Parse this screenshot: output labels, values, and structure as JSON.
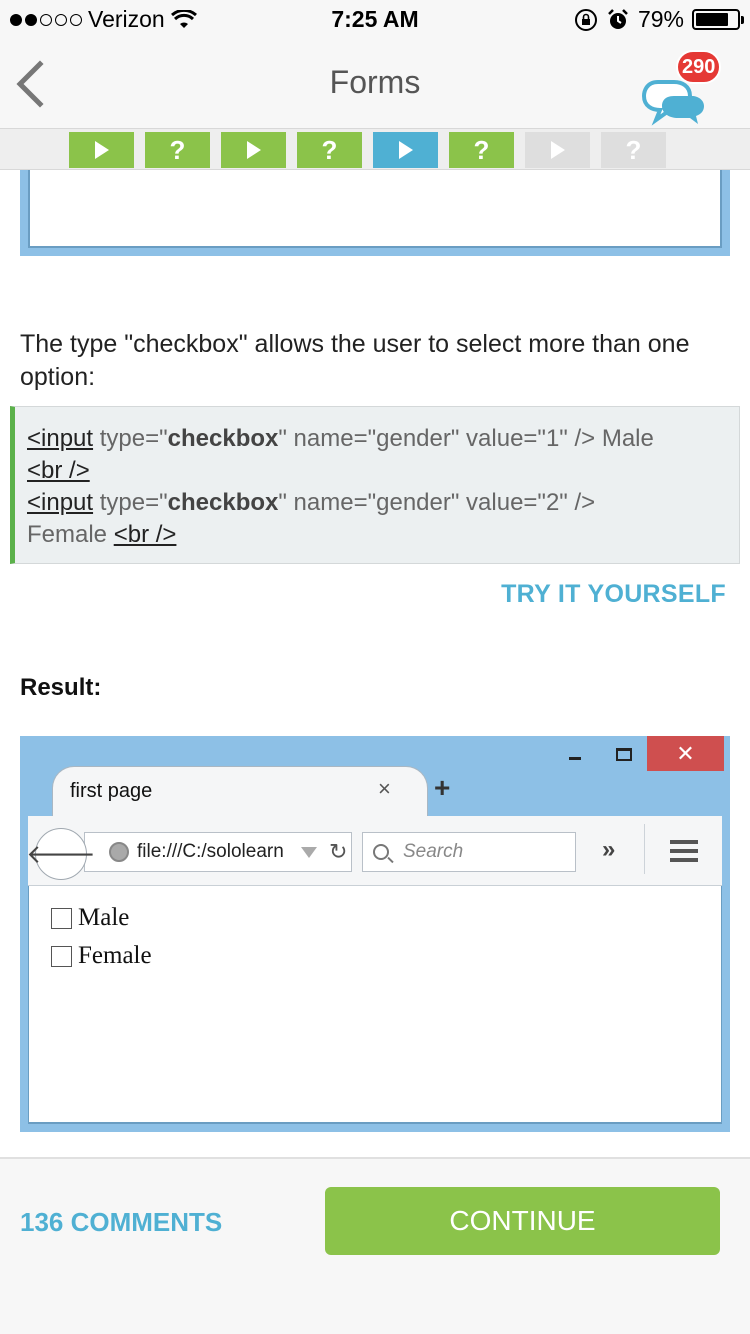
{
  "status_bar": {
    "carrier": "Verizon",
    "time": "7:25 AM",
    "battery": "79%",
    "battery_level": 0.79,
    "signal_bars_filled": 2,
    "signal_bars_total": 5
  },
  "nav": {
    "title": "Forms",
    "badge_count": "290"
  },
  "progress_steps": [
    {
      "kind": "play",
      "state": "done",
      "glyph": ""
    },
    {
      "kind": "quiz",
      "state": "done",
      "glyph": "?"
    },
    {
      "kind": "play",
      "state": "done",
      "glyph": ""
    },
    {
      "kind": "quiz",
      "state": "done",
      "glyph": "?"
    },
    {
      "kind": "play",
      "state": "current",
      "glyph": ""
    },
    {
      "kind": "quiz",
      "state": "done",
      "glyph": "?"
    },
    {
      "kind": "play",
      "state": "todo",
      "glyph": ""
    },
    {
      "kind": "quiz",
      "state": "todo",
      "glyph": "?"
    }
  ],
  "lesson": {
    "paragraph": "The type \"checkbox\" allows the user to select more than one option:",
    "code": {
      "line1_tag": "<input",
      "line1_type_pre": " type=\"",
      "line1_type_kw": "checkbox",
      "line1_rest": "\" name=\"gender\" value=\"1\" /> Male",
      "line2_br": "<br />",
      "line3_tag": "<input",
      "line3_type_pre": " type=\"",
      "line3_type_kw": "checkbox",
      "line3_rest": "\" name=\"gender\" value=\"2\" />",
      "line4_text": "Female ",
      "line4_br": "<br />"
    },
    "try_it": "TRY IT YOURSELF",
    "result_label": "Result:"
  },
  "browser": {
    "tab_title": "first page",
    "tab_close": "×",
    "new_tab": "+",
    "window_close": "✕",
    "url": "file:///C:/sololearn",
    "search_placeholder": "Search",
    "overflow": "»",
    "checkboxes": [
      {
        "label": "Male",
        "checked": false
      },
      {
        "label": "Female",
        "checked": false
      }
    ]
  },
  "bottom": {
    "comments": "136 COMMENTS",
    "continue": "CONTINUE"
  },
  "colors": {
    "accent_blue": "#4fb0d3",
    "accent_green": "#8bc34a",
    "badge_red": "#e53935"
  }
}
